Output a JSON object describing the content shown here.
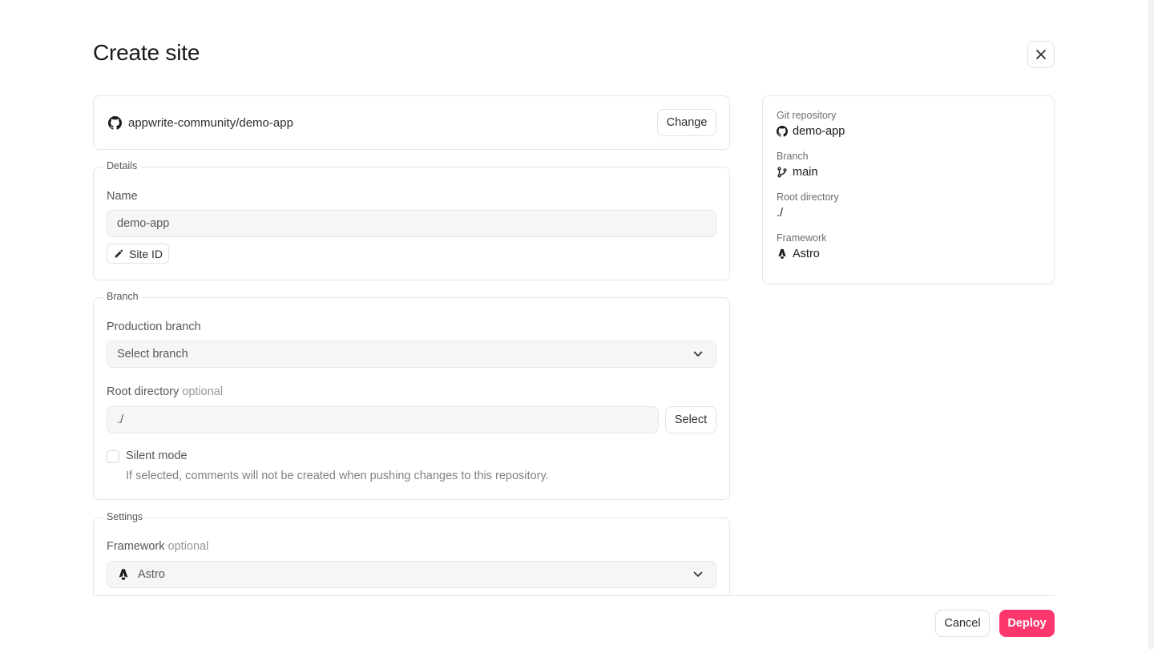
{
  "page": {
    "title": "Create site"
  },
  "repo": {
    "name": "appwrite-community/demo-app",
    "change_label": "Change"
  },
  "details": {
    "legend": "Details",
    "name_label": "Name",
    "name_value": "demo-app",
    "site_id_label": "Site ID"
  },
  "branch": {
    "legend": "Branch",
    "production_label": "Production branch",
    "production_placeholder": "Select branch",
    "root_label": "Root directory",
    "root_optional": "optional",
    "root_value": "./",
    "select_label": "Select",
    "silent_label": "Silent mode",
    "silent_description": "If selected, comments will not be created when pushing changes to this repository.",
    "silent_checked": false
  },
  "settings": {
    "legend": "Settings",
    "framework_label": "Framework",
    "framework_optional": "optional",
    "framework_value": "Astro"
  },
  "summary": {
    "git_label": "Git repository",
    "git_value": "demo-app",
    "branch_label": "Branch",
    "branch_value": "main",
    "root_label": "Root directory",
    "root_value": "./",
    "framework_label": "Framework",
    "framework_value": "Astro"
  },
  "footer": {
    "cancel_label": "Cancel",
    "deploy_label": "Deploy"
  },
  "colors": {
    "accent": "#fd366e",
    "border": "#e6e6e9",
    "input_bg": "#f6f6f7"
  },
  "icons": [
    "close-icon",
    "github-icon",
    "pencil-icon",
    "chevron-down-icon",
    "astro-icon",
    "branch-icon"
  ]
}
